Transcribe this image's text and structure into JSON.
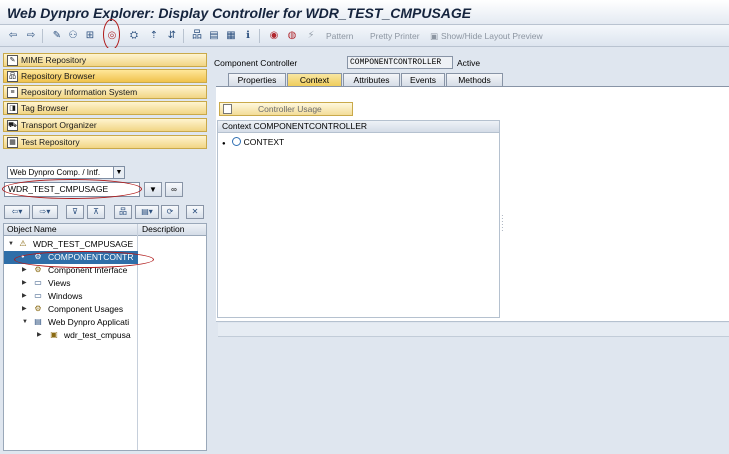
{
  "window": {
    "title": "Web Dynpro Explorer: Display Controller for WDR_TEST_CMPUSAGE"
  },
  "toolbar": {
    "pattern_label": "Pattern",
    "pretty_printer_label": "Pretty Printer",
    "show_hide_layout_label": "Show/Hide Layout Preview"
  },
  "nav": {
    "items": [
      {
        "label": "MIME Repository",
        "icon": "mime-icon"
      },
      {
        "label": "Repository Browser",
        "icon": "repository-icon"
      },
      {
        "label": "Repository Information System",
        "icon": "info-system-icon"
      },
      {
        "label": "Tag Browser",
        "icon": "tag-icon"
      },
      {
        "label": "Transport Organizer",
        "icon": "transport-icon"
      },
      {
        "label": "Test Repository",
        "icon": "test-icon"
      }
    ]
  },
  "object_selector": {
    "type_value": "Web Dynpro Comp. / Intf.",
    "object_value": "WDR_TEST_CMPUSAGE"
  },
  "tree": {
    "col_name": "Object Name",
    "col_description": "Description",
    "nodes": [
      {
        "label": "WDR_TEST_CMPUSAGE"
      },
      {
        "label": "COMPONENTCONTR"
      },
      {
        "label": "Component Interface"
      },
      {
        "label": "Views"
      },
      {
        "label": "Windows"
      },
      {
        "label": "Component Usages"
      },
      {
        "label": "Web Dynpro Applicati"
      },
      {
        "label": "wdr_test_cmpusa"
      }
    ]
  },
  "controller": {
    "label": "Component Controller",
    "name": "COMPONENTCONTROLLER",
    "status": "Active"
  },
  "tabs": [
    {
      "label": "Properties"
    },
    {
      "label": "Context"
    },
    {
      "label": "Attributes"
    },
    {
      "label": "Events"
    },
    {
      "label": "Methods"
    }
  ],
  "active_tab": "Context",
  "context_panel": {
    "usage_button": "Controller Usage",
    "header": "Context COMPONENTCONTROLLER",
    "root_node": "CONTEXT"
  },
  "colors": {
    "nav_button": "#f1d585",
    "selection": "#2e6ea8",
    "highlight_oval": "#b01a1a"
  }
}
